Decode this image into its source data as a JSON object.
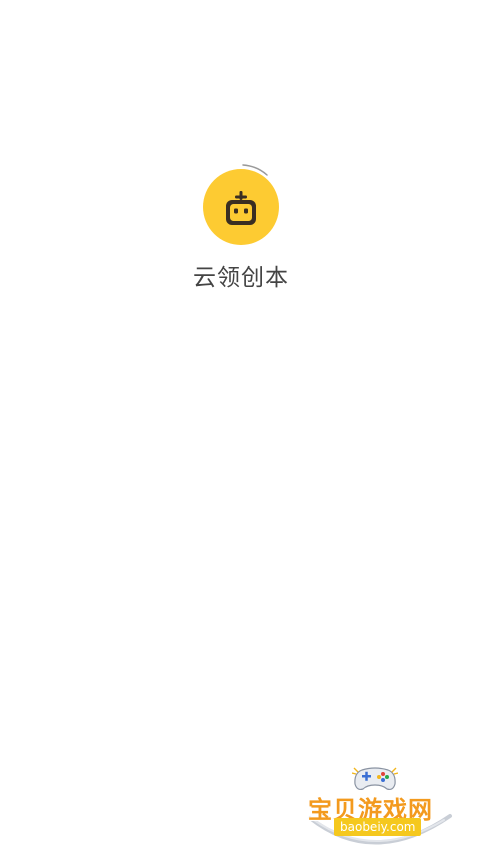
{
  "app": {
    "name": "云领创本",
    "logo_icon": "robot-icon",
    "logo_color": "#FDCB32",
    "robot_color": "#3A2E22"
  },
  "watermark": {
    "title": "宝贝游戏网",
    "domain": "baobeiy.com",
    "title_color": "#F39A1E",
    "domain_bg": "#F5C81E",
    "icon": "gamepad-icon"
  }
}
